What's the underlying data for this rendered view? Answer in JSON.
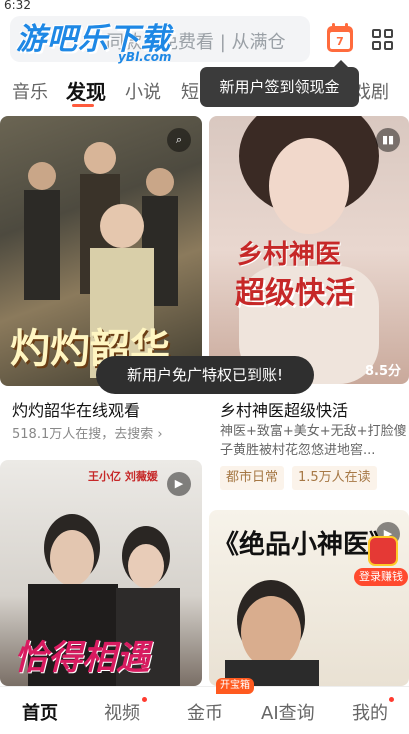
{
  "status": {
    "time": "6:32"
  },
  "search": {
    "text": "同款…免费看 | 从满仓",
    "watermark": "游吧乐下载",
    "watermark_sub": "yBl.com"
  },
  "header": {
    "calendar_day": "7",
    "calendar_icon": "calendar-checkin-icon",
    "grid_icon": "grid-menu-icon",
    "checkin_tooltip": "新用户签到领现金"
  },
  "tabs": [
    {
      "label": "音乐"
    },
    {
      "label": "发现"
    },
    {
      "label": "小说"
    },
    {
      "label": "短"
    },
    {
      "label": "戏剧"
    }
  ],
  "cards": [
    {
      "title": "灼灼韶华在线观看",
      "subtitle": "518.1万人在搜，去搜索",
      "poster_text": "灼灼韶华",
      "corner_icon": "search-icon"
    },
    {
      "title": "乡村神医超级快活",
      "description": "神医+致富+美女+无敌+打脸傻子黄胜被村花忽悠进地窖...",
      "poster_line1": "乡村神医",
      "poster_line2": "超级快活",
      "score": "8.5分",
      "tags": [
        "都市日常",
        "1.5万人在读"
      ],
      "corner_icon": "book-icon"
    },
    {
      "poster_text": "恰得相遇",
      "poster_small": "王小亿 刘薇媛",
      "corner_icon": "play-icon"
    },
    {
      "poster_text": "《绝品小神医》",
      "corner_icon": "play-icon"
    }
  ],
  "free_ads_toast": "新用户免广特权已到账!",
  "reward": {
    "label": "登录赚钱"
  },
  "bottom_nav": [
    {
      "label": "首页"
    },
    {
      "label": "视频"
    },
    {
      "label": "金币"
    },
    {
      "label": "AI查询"
    },
    {
      "label": "我的"
    }
  ],
  "coin_badge": "开宝箱",
  "colors": {
    "accent": "#ff5a3c",
    "tag_bg": "#fbf3ea",
    "tag_text": "#a67845",
    "watermark": "#1e88e5"
  }
}
